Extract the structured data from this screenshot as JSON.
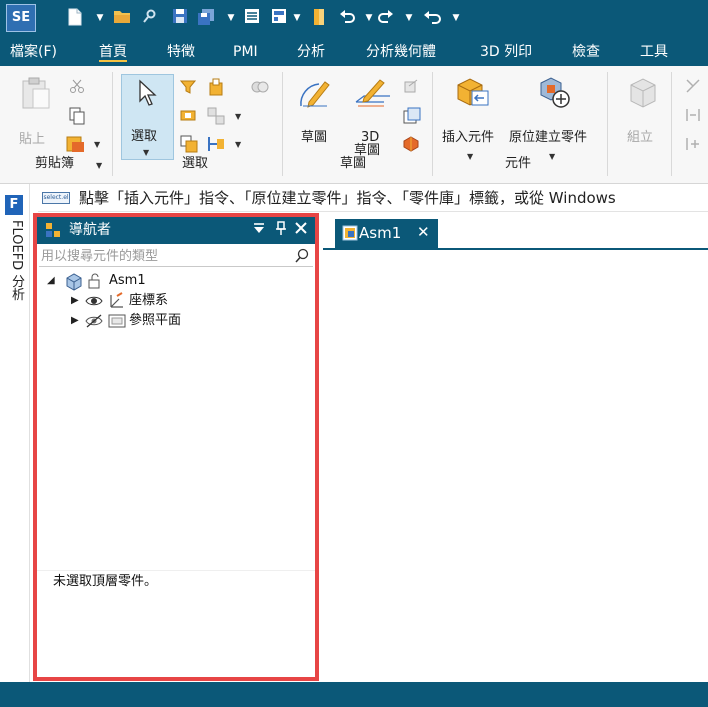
{
  "app": {
    "logo_text": "SE"
  },
  "menu": {
    "tabs": [
      {
        "label": "檔案(F)"
      },
      {
        "label": "首頁"
      },
      {
        "label": "特徵"
      },
      {
        "label": "PMI"
      },
      {
        "label": "分析"
      },
      {
        "label": "分析幾何體"
      },
      {
        "label": "3D 列印"
      },
      {
        "label": "檢查"
      },
      {
        "label": "工具"
      }
    ],
    "active": "首頁"
  },
  "ribbon": {
    "clipboard": {
      "paste_label": "貼上",
      "group_label": "剪貼簿"
    },
    "select": {
      "select_label": "選取",
      "group_label": "選取"
    },
    "sketch": {
      "sketch_label": "草圖",
      "sketch3d_label_1": "3D",
      "sketch3d_label_2": "草圖",
      "group_label": "草圖"
    },
    "components": {
      "insert_label": "插入元件",
      "inplace_label": "原位建立零件",
      "group_label": "元件"
    },
    "assemble": {
      "assemble_label": "組立"
    }
  },
  "prompt": {
    "chip_text": "select.el",
    "text": "點擊「插入元件」指令、「原位建立零件」指令、「零件庫」標籤，或從 Windows"
  },
  "leftstrip": {
    "icon_letter": "F",
    "label": "FLOEFD 分析"
  },
  "navigator": {
    "title": "導航者",
    "search_placeholder": "用以搜尋元件的類型",
    "tree": [
      {
        "label": "Asm1"
      },
      {
        "label": "座標系"
      },
      {
        "label": "參照平面"
      }
    ],
    "footer": "未選取頂層零件。",
    "highlight_color": "#e74545"
  },
  "document": {
    "tab_title": "Asm1"
  },
  "colors": {
    "chrome": "#0b5878",
    "accent": "#f5c242"
  }
}
